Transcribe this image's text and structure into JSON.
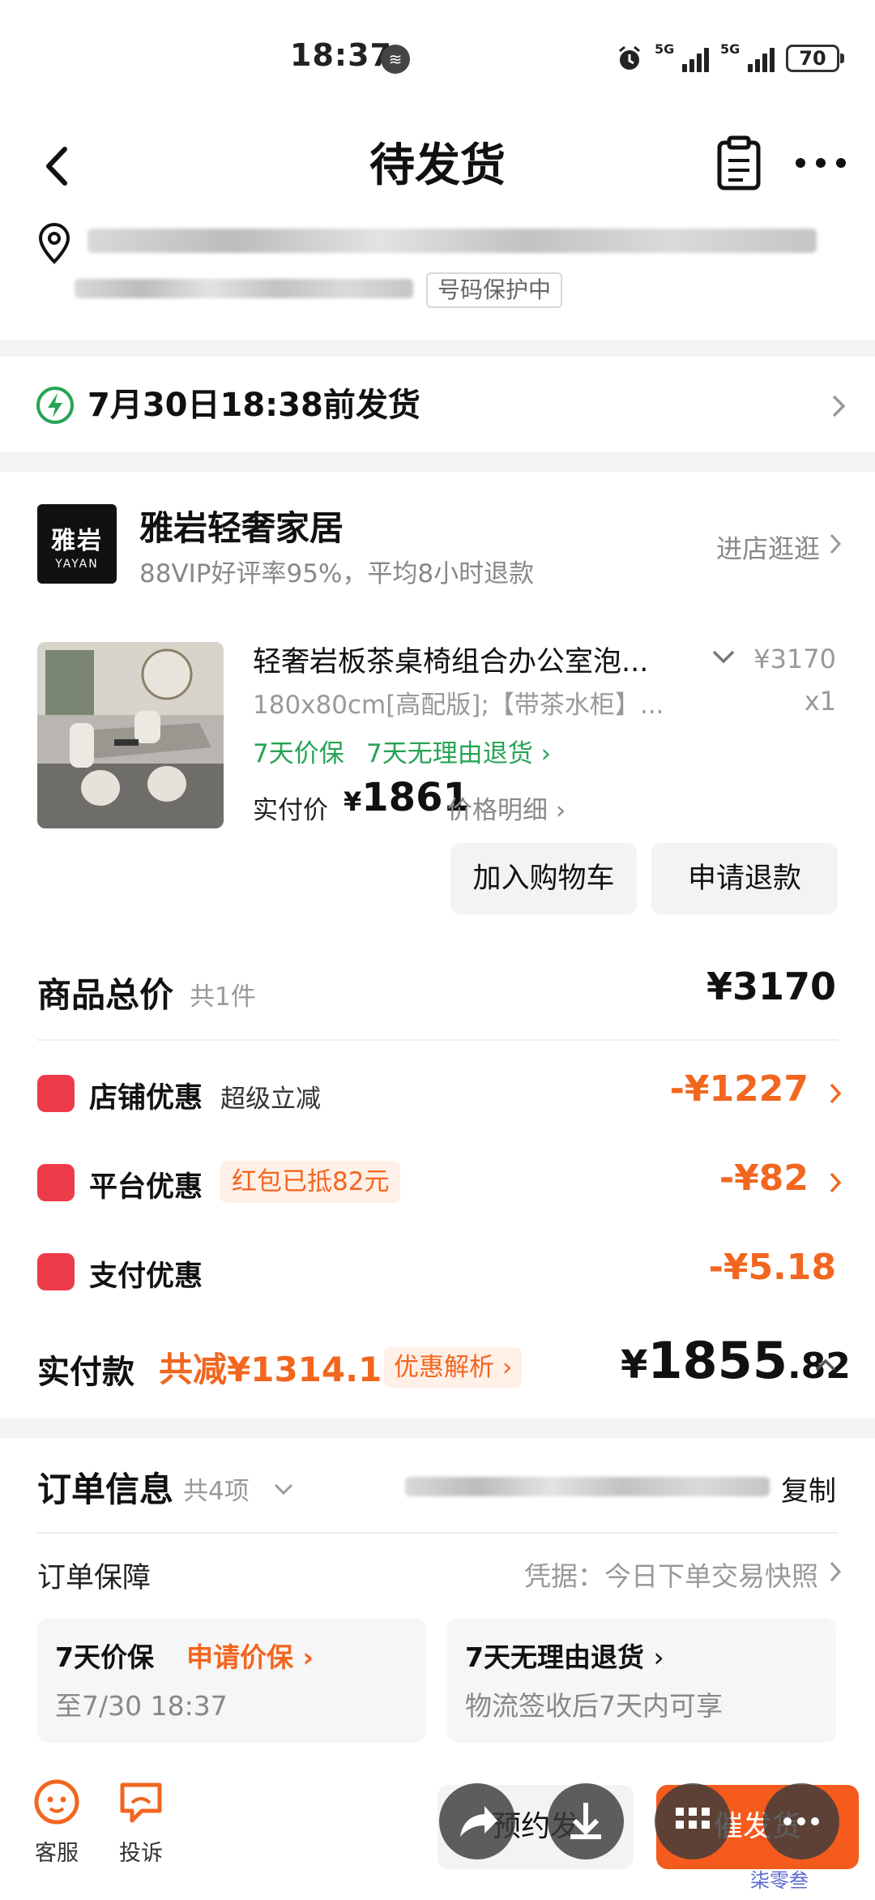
{
  "status": {
    "time": "18:37",
    "net1": "5G",
    "net2": "5G",
    "battery": "70"
  },
  "header": {
    "title": "待发货"
  },
  "address": {
    "protect_badge": "号码保护中"
  },
  "shipping": {
    "deadline": "7月30日18:38前发货"
  },
  "store": {
    "logo_cn": "雅岩",
    "logo_en": "YAYAN",
    "name": "雅岩轻奢家居",
    "subtitle": "88VIP好评率95%，平均8小时退款",
    "visit": "进店逛逛"
  },
  "product": {
    "title": "轻奢岩板茶桌椅组合办公室泡...",
    "spec": "180x80cm[高配版];【带茶水柜】...",
    "price": "¥3170",
    "qty": "x1",
    "guarantee_1": "7天价保",
    "guarantee_2": "7天无理由退货",
    "paid_label": "实付价",
    "paid_currency": "¥",
    "paid_value": "1861",
    "price_detail": "价格明细",
    "btn_cart": "加入购物车",
    "btn_refund": "申请退款"
  },
  "summary": {
    "total_label": "商品总价",
    "total_count": "共1件",
    "total_value": "¥3170",
    "discounts": [
      {
        "label": "店铺优惠",
        "sub": "超级立减",
        "amount": "-¥1227"
      },
      {
        "label": "平台优惠",
        "sub": "红包已抵82元",
        "amount": "-¥82"
      },
      {
        "label": "支付优惠",
        "sub": "",
        "amount": "-¥5.18"
      }
    ],
    "pay_label": "实付款",
    "pay_reduce": "共减¥1314.18",
    "pay_analysis": "优惠解析",
    "pay_currency": "¥",
    "pay_int": "1855",
    "pay_dec": ".82"
  },
  "order": {
    "title": "订单信息",
    "count": "共4项",
    "copy": "复制",
    "guarantee_label": "订单保障",
    "proof": "凭据：今日下单交易快照",
    "box1_title": "7天价保",
    "box1_action": "申请价保",
    "box1_sub": "至7/30 18:37",
    "box2_title": "7天无理由退货",
    "box2_sub": "物流签收后7天内可享"
  },
  "bottom": {
    "tab_service": "客服",
    "tab_complain": "投诉",
    "btn_remind": "预约发",
    "btn_urge": "催发货"
  },
  "watermark": "柒零叁",
  "colors": {
    "accent": "#f2661f",
    "green": "#26a453",
    "discount_icon": "#ee3b4a",
    "urge_button": "#f45b1d"
  }
}
